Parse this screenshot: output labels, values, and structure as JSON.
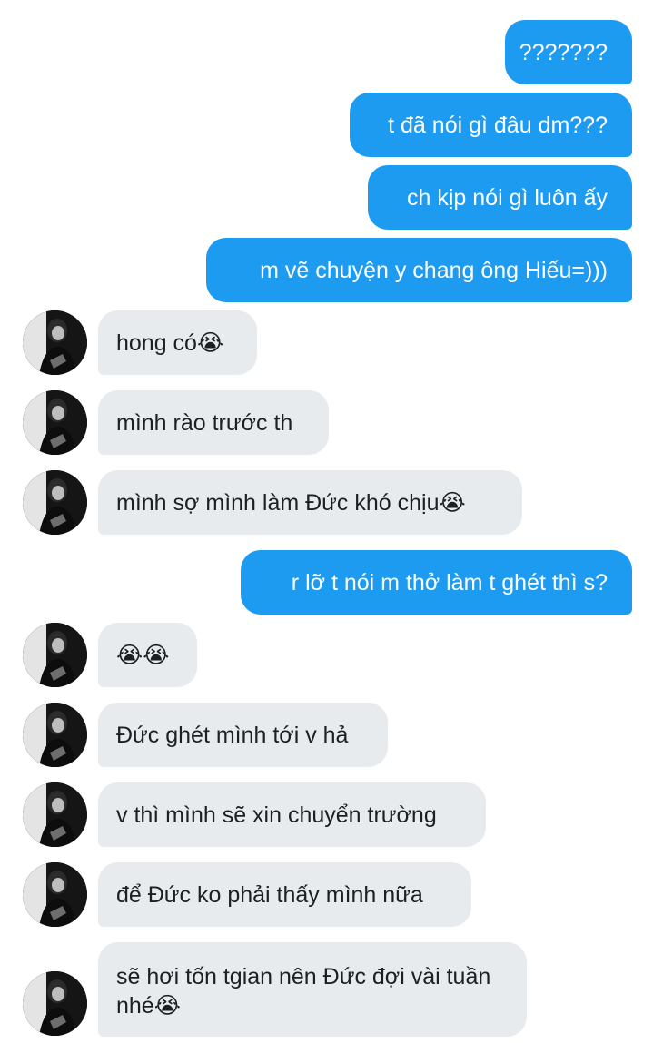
{
  "messages": {
    "m1": "???????",
    "m2": "t đã nói gì đâu dm???",
    "m3": "ch kịp nói gì luôn ấy",
    "m4": "m vẽ chuyện y chang ông Hiếu=)))",
    "m5": "hong có😭",
    "m6": "mình rào trước th",
    "m7": "mình sợ mình làm Đức khó chịu😭",
    "m8": "r lỡ t nói m thở làm t ghét thì s?",
    "m9": "😭😭",
    "m10": "Đức ghét mình tới v hả",
    "m11": "v thì mình sẽ xin chuyển trường",
    "m12": "để Đức ko phải thấy mình nữa",
    "m13": "sẽ hơi tốn tgian nên Đức đợi vài tuần nhé😭"
  },
  "colors": {
    "outgoing_bubble": "#1d9bf0",
    "incoming_bubble": "#e7ebee",
    "incoming_text": "#1c1f23"
  }
}
